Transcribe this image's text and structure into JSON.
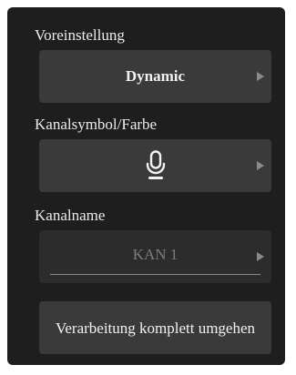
{
  "preset": {
    "label": "Voreinstellung",
    "value": "Dynamic"
  },
  "channel_icon": {
    "label": "Kanalsymbol/Farbe",
    "icon": "microphone-icon"
  },
  "channel_name": {
    "label": "Kanalname",
    "value": "KAN 1"
  },
  "bypass": {
    "label": "Verarbeitung komplett umgehen"
  },
  "colors": {
    "panel_background": "#1e1e1e",
    "control_background": "#3a3a3a",
    "text": "#f2f2f2",
    "disabled_text": "#7c7c7c"
  }
}
